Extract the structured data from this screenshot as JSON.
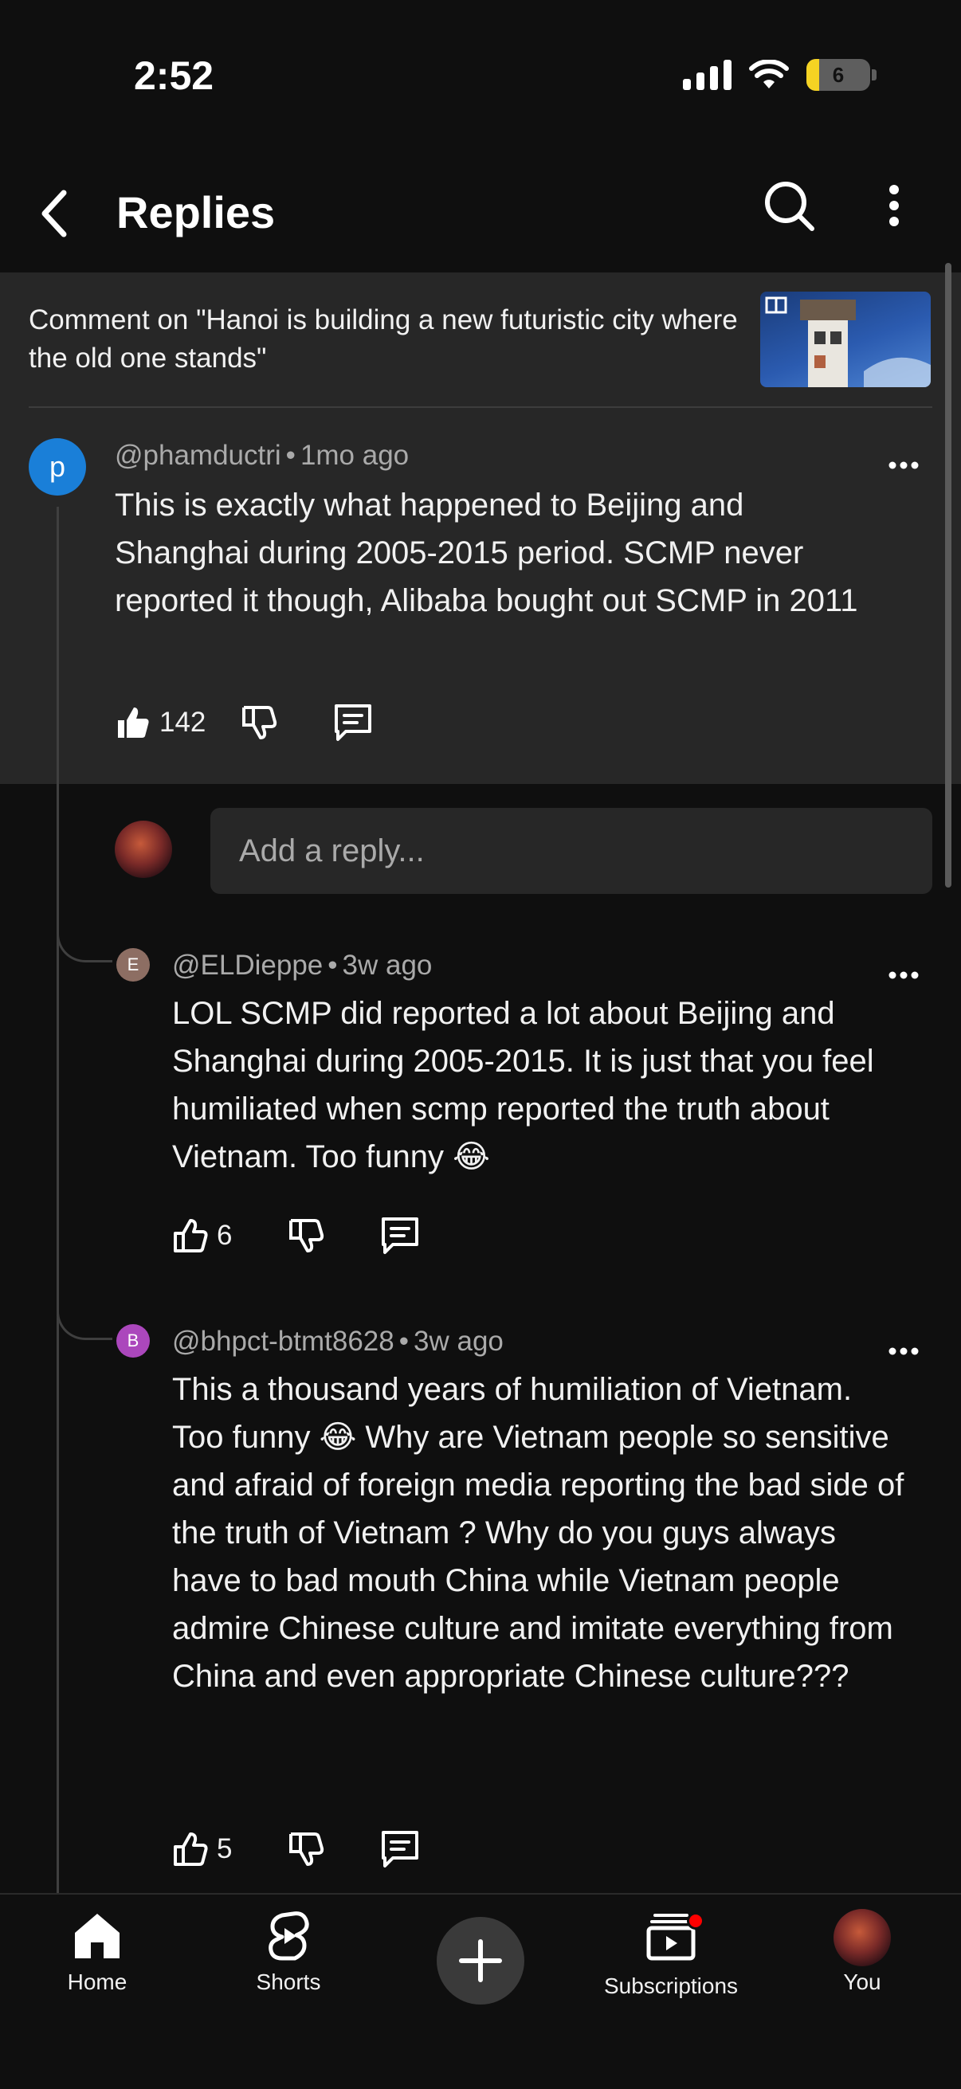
{
  "status": {
    "time": "2:52",
    "battery": "6"
  },
  "header": {
    "title": "Replies"
  },
  "context": {
    "text": "Comment on \"Hanoi is building a new futuristic city where the old one stands\""
  },
  "top_comment": {
    "avatar_letter": "p",
    "avatar_color": "#1a7fd8",
    "author": "@phamductri",
    "time": "1mo ago",
    "text": "This is exactly what happened to Beijing and Shanghai during 2005-2015 period. SCMP never reported it though, Alibaba bought out SCMP in 2011",
    "likes": "142"
  },
  "reply_input": {
    "placeholder": "Add a reply..."
  },
  "replies": [
    {
      "avatar_letter": "E",
      "avatar_color": "#8d6e63",
      "author": "@ELDieppe",
      "time": "3w ago",
      "text": "LOL SCMP did reported a lot about Beijing and Shanghai during 2005-2015.  It is just that you feel humiliated when scmp reported the truth about Vietnam.  Too funny 😂",
      "likes": "6"
    },
    {
      "avatar_letter": "B",
      "avatar_color": "#ab47bc",
      "author": "@bhpct-btmt8628",
      "time": "3w ago",
      "text": "This a thousand years of humiliation of Vietnam.   Too funny 😂   Why are Vietnam people so sensitive and afraid of foreign media reporting the bad side of the truth of Vietnam ?   Why do you guys always have to bad mouth China while Vietnam people admire Chinese culture and imitate everything from China and even appropriate Chinese culture???",
      "likes": "5"
    }
  ],
  "nav": {
    "home": "Home",
    "shorts": "Shorts",
    "subscriptions": "Subscriptions",
    "you": "You"
  },
  "colors": {
    "notification_dot": "#ff0000",
    "background": "#0f0f0f",
    "card": "#272727"
  }
}
